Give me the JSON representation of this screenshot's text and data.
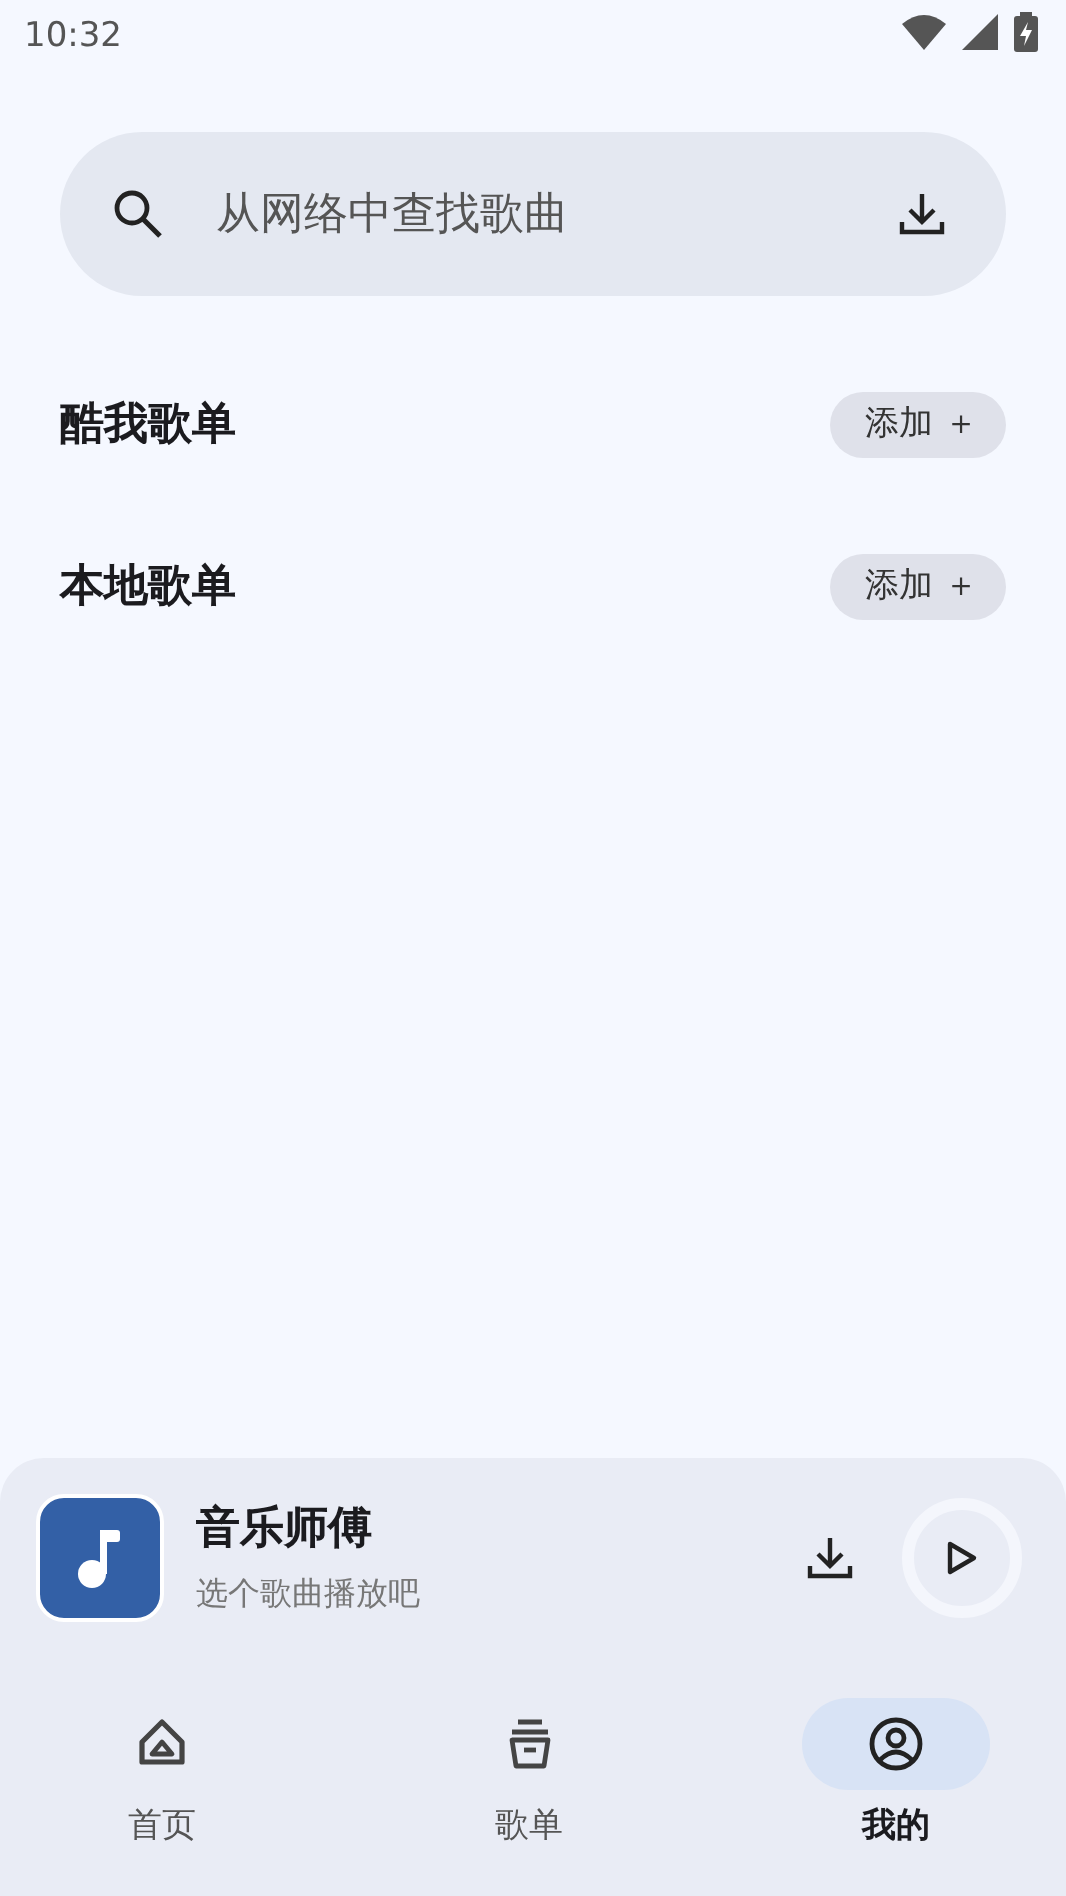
{
  "status_bar": {
    "time": "10:32"
  },
  "search": {
    "placeholder": "从网络中查找歌曲"
  },
  "playlists": [
    {
      "title": "酷我歌单",
      "action": "添加 ＋"
    },
    {
      "title": "本地歌单",
      "action": "添加 ＋"
    }
  ],
  "player": {
    "title": "音乐师傅",
    "subtitle": "选个歌曲播放吧"
  },
  "nav": [
    {
      "label": "首页",
      "kind": "home",
      "selected": false
    },
    {
      "label": "歌单",
      "kind": "playlist",
      "selected": false
    },
    {
      "label": "我的",
      "kind": "profile",
      "selected": true
    }
  ]
}
